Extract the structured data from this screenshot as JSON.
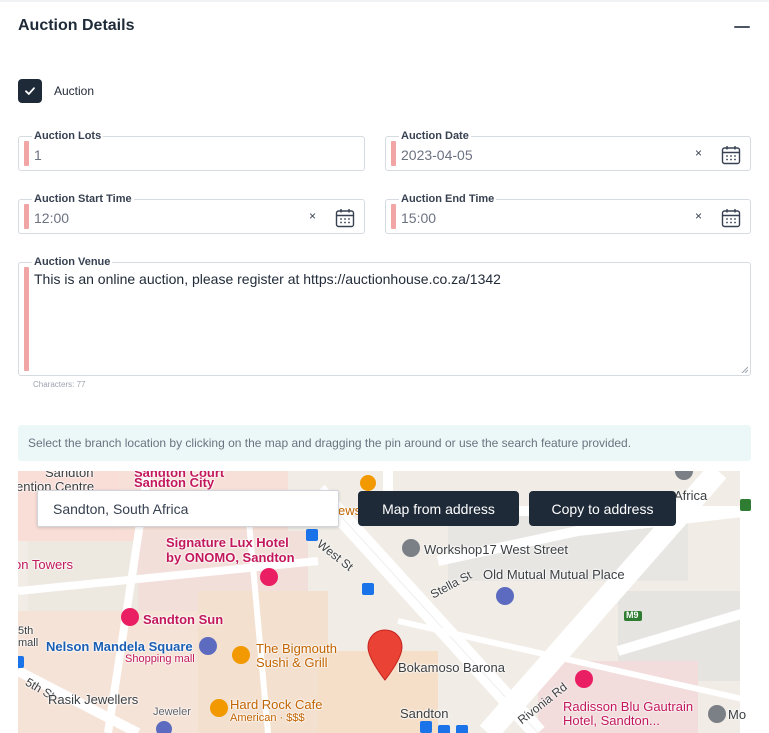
{
  "section": {
    "title": "Auction Details"
  },
  "auction_checkbox": {
    "label": "Auction",
    "checked": true
  },
  "fields": {
    "lots": {
      "label": "Auction Lots",
      "value": "1"
    },
    "date": {
      "label": "Auction Date",
      "value": "2023-04-05",
      "clear": "×"
    },
    "start_time": {
      "label": "Auction Start Time",
      "value": "12:00",
      "clear": "×"
    },
    "end_time": {
      "label": "Auction End Time",
      "value": "15:00",
      "clear": "×"
    },
    "venue": {
      "label": "Auction Venue",
      "value": "This is an online auction, please register at https://auctionhouse.co.za/1342",
      "characters": "Characters: 77"
    }
  },
  "info_text": "Select the branch location by clicking on the map and dragging the pin around or use the search feature provided.",
  "map": {
    "search_value": "Sandton, South Africa",
    "map_from_address_label": "Map from address",
    "copy_to_address_label": "Copy to address",
    "labels": {
      "sandton_top": "Sandton",
      "convention_centre": "ention Centre",
      "sandton_court": "Sandton Court",
      "sandton_city": "Sandton City",
      "ews": "ews",
      "africa": "Africa",
      "signature_lux_1": "Signature Lux Hotel",
      "signature_lux_2": "by ONOMO, Sandton",
      "west_st": "West St",
      "workshop17": "Workshop17 West Street",
      "stella_st": "Stella St",
      "old_mutual": "Old Mutual Mutual Place",
      "m9": "M9",
      "on_towers": "on Towers",
      "sandton_sun": "Sandton Sun",
      "fifth_top": "5th",
      "mall": "mall",
      "nelson_mandela": "Nelson Mandela Square",
      "shopping_mall": "Shopping mall",
      "bigmouth_1": "The Bigmouth",
      "bigmouth_2": "Sushi & Grill",
      "bokamoso": "Bokamoso Barona",
      "fifth_st": "5th St",
      "rasik": "Rasik Jewellers",
      "jeweler": "Jeweler",
      "hard_rock": "Hard Rock Cafe",
      "american": "American · $$$",
      "sandton_bottom": "Sandton",
      "rivonia_rd": "Rivonia Rd",
      "radisson_1": "Radisson Blu Gautrain",
      "radisson_2": "Hotel, Sandton...",
      "mo": "Mo"
    }
  },
  "colors": {
    "primary": "#1e2a38",
    "required_flag": "#f2a5a5",
    "info_bg": "#ecf8f8",
    "pin": "#ea4335"
  }
}
